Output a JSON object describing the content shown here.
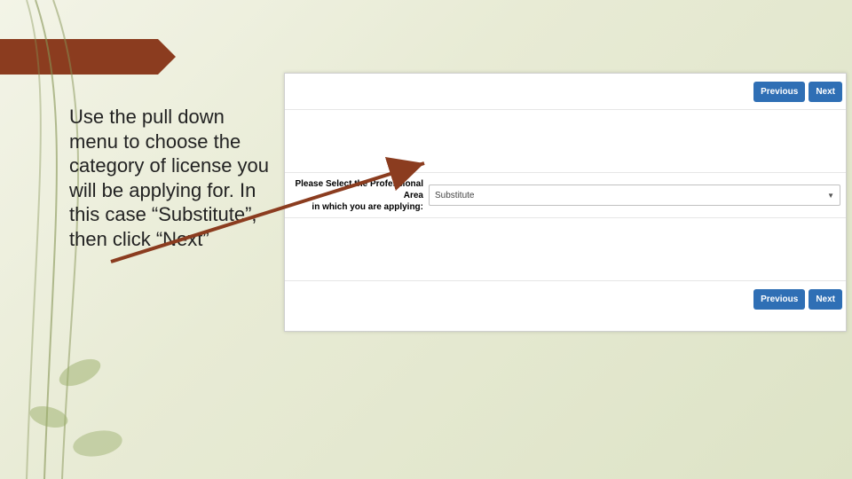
{
  "instruction": "Use the pull down menu to choose the category of license you will be applying for. In this case “Substitute”, then click “Next”",
  "panel": {
    "nav_previous": "Previous",
    "nav_next": "Next",
    "prompt_line1": "Please Select the Professional Area",
    "prompt_line2": "in which you are applying:",
    "selected_value": "Substitute"
  },
  "colors": {
    "button_bg": "#2f6fb5",
    "banner": "#8b3c1f"
  }
}
